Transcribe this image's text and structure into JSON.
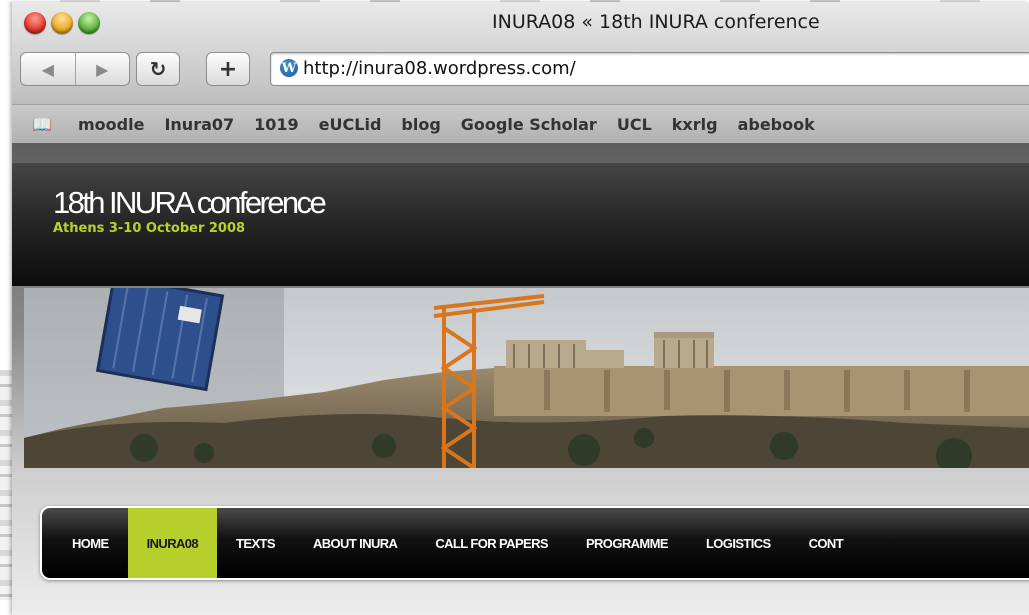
{
  "window": {
    "title": "INURA08 « 18th INURA conference"
  },
  "toolbar": {
    "back_icon": "back-arrow-icon",
    "forward_icon": "forward-arrow-icon",
    "reload_icon": "reload-icon",
    "add_bookmark_icon": "plus-icon",
    "url": "http://inura08.wordpress.com/",
    "favicon": "wordpress-icon"
  },
  "bookmarks": {
    "icon": "book-icon",
    "items": [
      "moodle",
      "Inura07",
      "1019",
      "eUCLid",
      "blog",
      "Google Scholar",
      "UCL",
      "kxrlg",
      "abebook"
    ]
  },
  "site": {
    "title": "18th INURA conference",
    "tagline": "Athens 3-10 October 2008",
    "accent": "#b6cf2b"
  },
  "nav": {
    "items": [
      "HOME",
      "INURA08",
      "TEXTS",
      "ABOUT INURA",
      "CALL FOR PAPERS",
      "PROGRAMME",
      "LOGISTICS",
      "CONT"
    ],
    "active_index": 1
  }
}
